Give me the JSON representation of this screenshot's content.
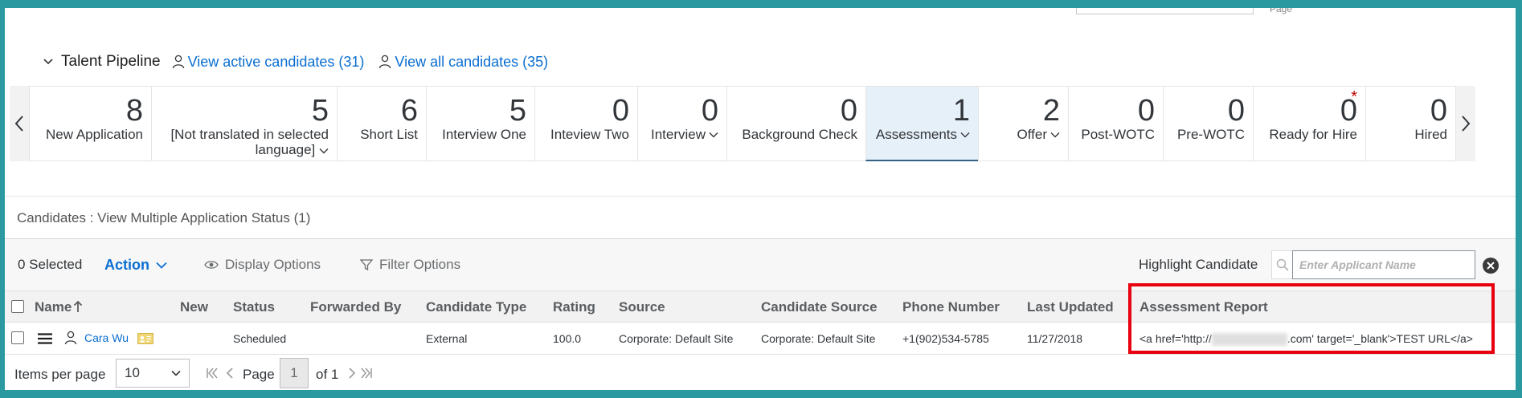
{
  "top_bar": {
    "page_fragment": "Page"
  },
  "pipeline": {
    "title": "Talent Pipeline",
    "active_link": "View active candidates (31)",
    "all_link": "View all candidates (35)",
    "steps": [
      {
        "count": "8",
        "label": "New Application"
      },
      {
        "count": "5",
        "label": "[Not translated in selected language]"
      },
      {
        "count": "6",
        "label": "Short List"
      },
      {
        "count": "5",
        "label": "Interview One"
      },
      {
        "count": "0",
        "label": "Inteview Two"
      },
      {
        "count": "0",
        "label": "Interview"
      },
      {
        "count": "0",
        "label": "Background Check"
      },
      {
        "count": "1",
        "label": "Assessments"
      },
      {
        "count": "2",
        "label": "Offer"
      },
      {
        "count": "0",
        "label": "Post-WOTC"
      },
      {
        "count": "0",
        "label": "Pre-WOTC"
      },
      {
        "count": "0",
        "label": "Ready for Hire"
      },
      {
        "count": "0",
        "label": "Hired"
      }
    ],
    "active_step": "Assessments"
  },
  "candidates": {
    "title": "Candidates : View Multiple Application Status (1)",
    "selected_count": "0 Selected",
    "action_label": "Action",
    "display_options": "Display Options",
    "filter_options": "Filter Options",
    "highlight_label": "Highlight Candidate",
    "highlight_placeholder": "Enter Applicant Name"
  },
  "table": {
    "headers": [
      "Name",
      "New",
      "Status",
      "Forwarded By",
      "Candidate Type",
      "Rating",
      "Source",
      "Candidate Source",
      "Phone Number",
      "Last Updated",
      "Assessment Report"
    ],
    "rows": [
      {
        "name": "Cara Wu",
        "new": "",
        "status": "Scheduled",
        "forwarded_by": "",
        "candidate_type": "External",
        "rating": "100.0",
        "source": "Corporate: Default Site",
        "candidate_source": "Corporate: Default Site",
        "phone": "+1(902)534-5785",
        "last_updated": "11/27/2018",
        "assessment_pre": "<a href='http://",
        "assessment_post": ".com' target='_blank'>TEST URL</a>"
      }
    ]
  },
  "pager": {
    "items_label": "Items per page",
    "items_value": "10",
    "page_label": "Page",
    "page_value": "1",
    "of_label": "of 1"
  },
  "colors": {
    "accent": "#0a6ed1",
    "frame": "#2a9aa0",
    "highlight_box": "#e8000f",
    "active_step_bg": "#e6f0f8"
  }
}
